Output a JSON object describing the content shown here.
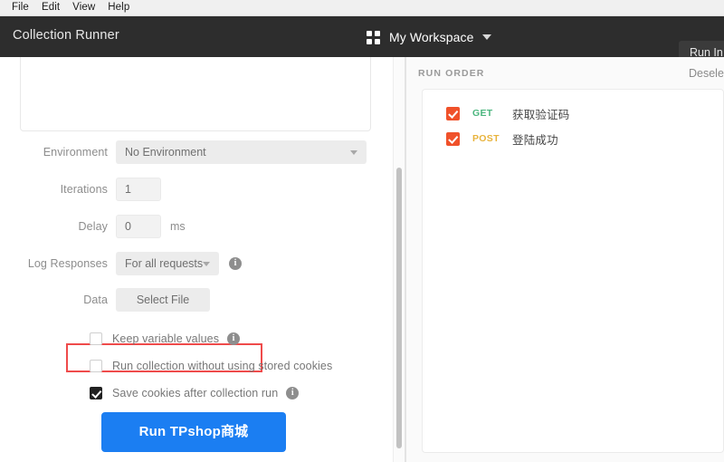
{
  "menubar": {
    "items": [
      {
        "label": "File"
      },
      {
        "label": "Edit"
      },
      {
        "label": "View"
      },
      {
        "label": "Help"
      }
    ]
  },
  "header": {
    "title": "Collection Runner",
    "workspace_label": "My Workspace",
    "workspace_icon": "grid-icon",
    "run_in_button": "Run In C",
    "accent_dark": "#2d2d2d"
  },
  "runner_form": {
    "environment": {
      "label": "Environment",
      "value": "No Environment"
    },
    "iterations": {
      "label": "Iterations",
      "value": "1"
    },
    "delay": {
      "label": "Delay",
      "value": "0",
      "unit": "ms"
    },
    "log_responses": {
      "label": "Log Responses",
      "value": "For all requests",
      "info_icon": "info-icon"
    },
    "data": {
      "label": "Data",
      "button_label": "Select File",
      "highlight_color": "#ef4b4b"
    },
    "options": [
      {
        "label": "Keep variable values",
        "checked": false,
        "has_info": true
      },
      {
        "label": "Run collection without using stored cookies",
        "checked": false,
        "has_info": false
      },
      {
        "label": "Save cookies after collection run",
        "checked": true,
        "has_info": true
      }
    ],
    "run_button": {
      "label": "Run TPshop商城",
      "color": "#1b7ef2"
    }
  },
  "run_order": {
    "title": "RUN ORDER",
    "deselect_label": "Desele",
    "requests": [
      {
        "method": "GET",
        "name": "获取验证码",
        "checked": true,
        "method_color": "#4cb67f"
      },
      {
        "method": "POST",
        "name": "登陆成功",
        "checked": true,
        "method_color": "#e8b33c"
      }
    ],
    "checkbox_color": "#f0512a"
  }
}
